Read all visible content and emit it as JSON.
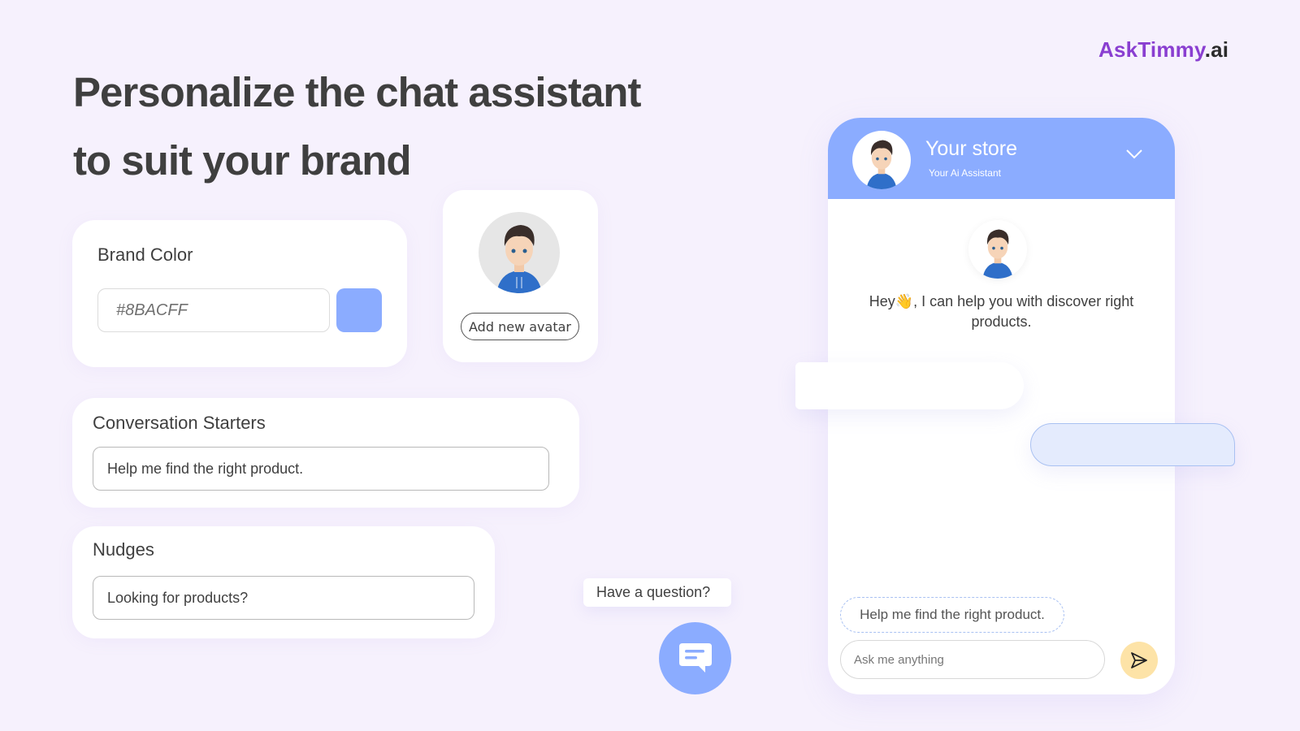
{
  "logo": {
    "part1": "AskTimmy",
    "part2": ".ai"
  },
  "headline": {
    "line1": "Personalize the chat assistant",
    "line2": "to suit your brand"
  },
  "brand_color": {
    "title": "Brand Color",
    "value": "#8BACFF",
    "swatch_color": "#8bacff"
  },
  "avatar_card": {
    "avatar_icon": "avatar-icon",
    "button_label": "Add new avatar"
  },
  "conversation_starters": {
    "title": "Conversation Starters",
    "value": "Help me find the right product."
  },
  "nudges": {
    "title": "Nudges",
    "value": "Looking for products?"
  },
  "launcher": {
    "tooltip": "Have a question?",
    "icon": "chat-bubble-icon"
  },
  "chat_widget": {
    "store_name": "Your store",
    "subtitle": "Your Ai Assistant",
    "welcome_text": "Hey👋, I can help you with discover right products.",
    "starter_chip": "Help me find the right product.",
    "input_placeholder": "Ask me anything",
    "send_icon": "send-icon",
    "collapse_icon": "chevron-down-icon"
  },
  "colors": {
    "brand": "#8bacff",
    "logo_purple": "#8a3fd1",
    "send_button": "#fde3a7",
    "background": "#f6f1fd"
  }
}
